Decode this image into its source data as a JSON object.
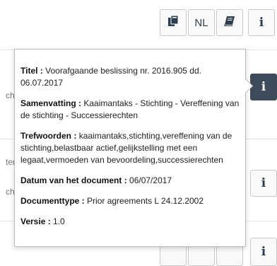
{
  "toolbar": {
    "copy_icon": "copy-document-icon",
    "language_label": "NL",
    "book_icon": "book-icon",
    "info_label": "i"
  },
  "background": {
    "fragments": [
      "cht",
      "ter",
      "cht"
    ]
  },
  "side_buttons": {
    "info_label": "i"
  },
  "popover": {
    "title_label": "Titel :",
    "title_value": "Voorafgaande beslissing nr. 2016.905 dd. 06.07.2017",
    "summary_label": "Samenvatting :",
    "summary_value": "Kaaimantaks - Stichting - Vereffening van de stichting - Successierechten",
    "keywords_label": "Trefwoorden :",
    "keywords_value": "kaaimantaks,stichting,vereffening van de stichting,belastbaar actief,gelijkstelling met een legaat,vermoeden van bevoordeling,successierechten",
    "date_label": "Datum van het document :",
    "date_value": "06/07/2017",
    "doctype_label": "Documenttype :",
    "doctype_value": "Prior agreements L 24.12.2002",
    "version_label": "Versie :",
    "version_value": "1.0"
  },
  "colors": {
    "active_button": "#3d4a5a",
    "button_border": "#c9c9c9",
    "icon_color": "#2c3e50"
  }
}
